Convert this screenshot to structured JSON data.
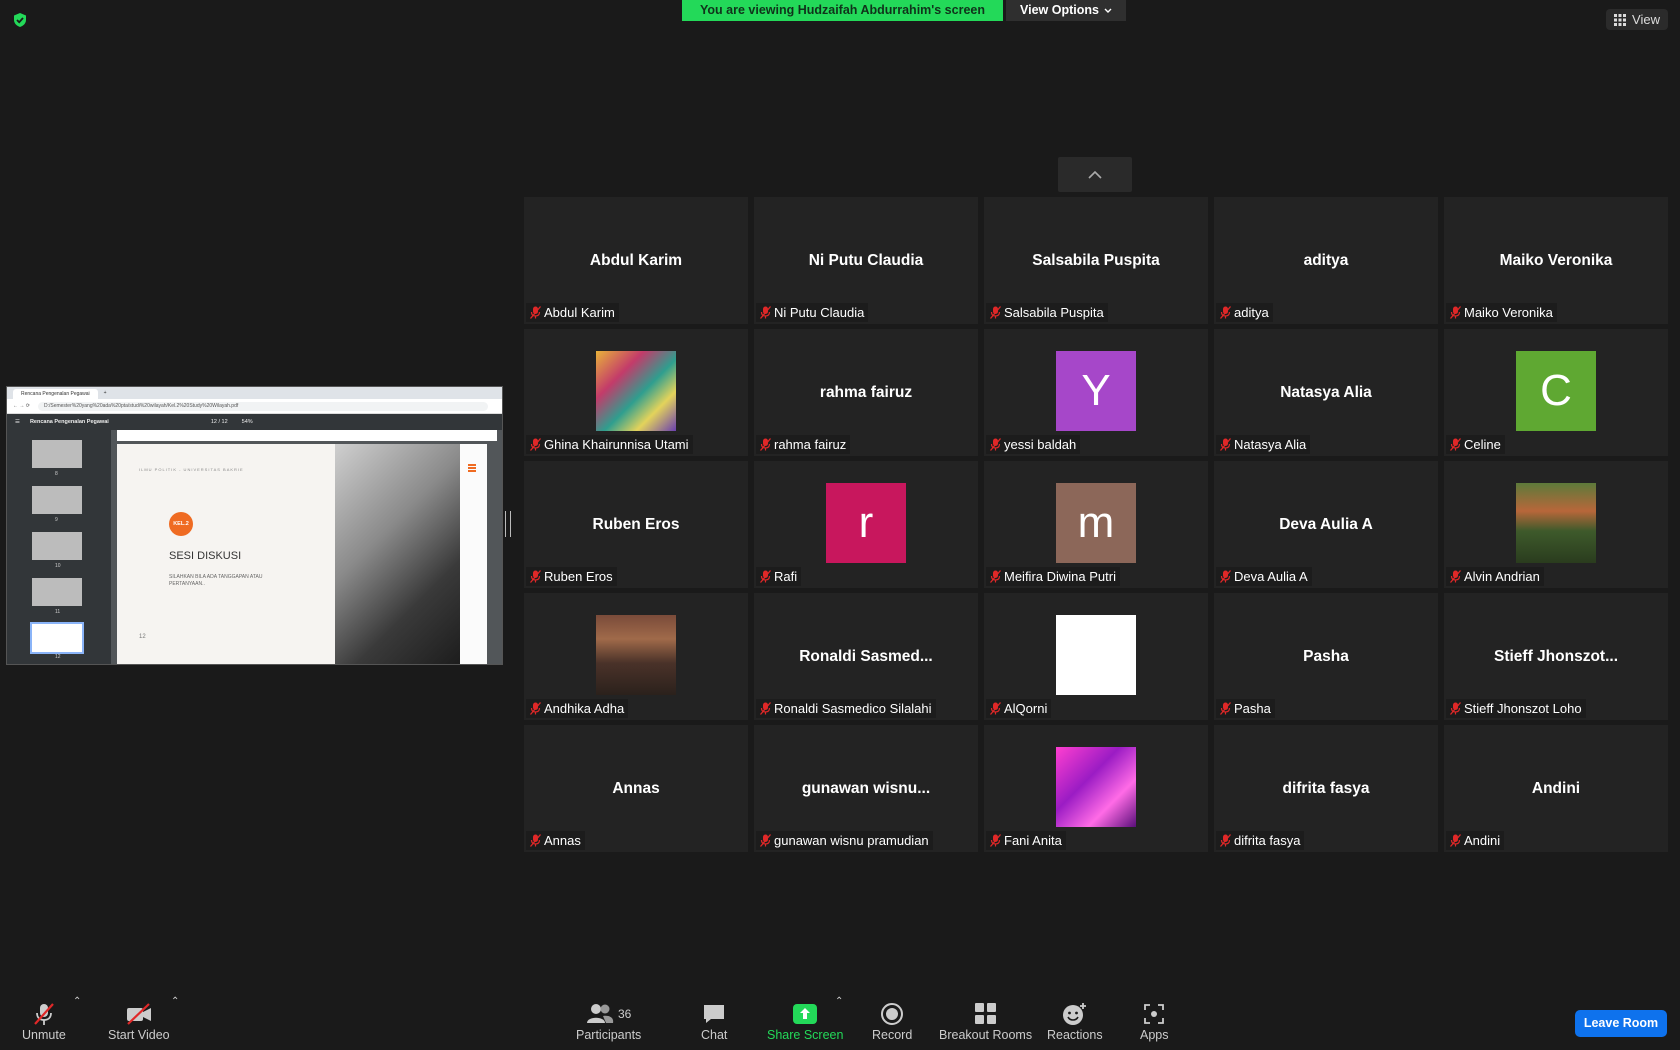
{
  "banner": {
    "message": "You are viewing Hudzaifah Abdurrahim's screen",
    "options": "View Options"
  },
  "view_button": "View",
  "shared_screen": {
    "tab": "Rencana Pengenalan Pegawai",
    "url": "D:/Semester%20yang%20ada%20pta/studi%20wilayah/Kel.2%20Study%20Wilayah.pdf",
    "doc_title": "Rencana Pengenalan Pegawai",
    "page": "12 / 12",
    "zoom": "54%",
    "thumb_numbers": [
      "8",
      "9",
      "10",
      "11",
      "12"
    ],
    "slide": {
      "header": "ILMU POLITIK - UNIVERSITAS BAKRIE",
      "badge": "KEL.2",
      "title": "SESI DISKUSI",
      "desc": "SILAHKAN BILA ADA TANGGAPAN ATAU PERTANYAAN..",
      "num": "12"
    }
  },
  "participants": [
    {
      "big": "Abdul Karim",
      "label": "Abdul Karim"
    },
    {
      "big": "Ni Putu Claudia",
      "label": "Ni Putu Claudia"
    },
    {
      "big": "Salsabila Puspita",
      "label": "Salsabila Puspita"
    },
    {
      "big": "aditya",
      "label": "aditya"
    },
    {
      "big": "Maiko Veronika",
      "label": "Maiko Veronika"
    },
    {
      "avatar": "photo-colorful-wall",
      "label": "Ghina Khairunnisa Utami"
    },
    {
      "big": "rahma fairuz",
      "label": "rahma fairuz"
    },
    {
      "avatar": "letter",
      "letter": "Y",
      "color": "#a647c9",
      "label": "yessi baldah"
    },
    {
      "big": "Natasya Alia",
      "label": "Natasya Alia"
    },
    {
      "avatar": "letter",
      "letter": "C",
      "color": "#5fa832",
      "label": "Celine"
    },
    {
      "big": "Ruben Eros",
      "label": "Ruben Eros"
    },
    {
      "avatar": "letter",
      "letter": "r",
      "color": "#c8175d",
      "label": "Rafi"
    },
    {
      "avatar": "letter",
      "letter": "m",
      "color": "#8c6759",
      "label": "Meifira Diwina Putri"
    },
    {
      "big": "Deva Aulia A",
      "label": "Deva Aulia A"
    },
    {
      "avatar": "photo-garden",
      "label": "Alvin Andrian"
    },
    {
      "avatar": "photo-portrait",
      "label": "Andhika Adha"
    },
    {
      "big": "Ronaldi  Sasmed...",
      "label": "Ronaldi Sasmedico Silalahi"
    },
    {
      "avatar": "letter",
      "letter": "",
      "color": "#ffffff",
      "label": "AlQorni"
    },
    {
      "big": "Pasha",
      "label": "Pasha"
    },
    {
      "big": "Stieff  Jhonszot...",
      "label": "Stieff Jhonszot Loho"
    },
    {
      "big": "Annas",
      "label": "Annas"
    },
    {
      "big": "gunawan  wisnu...",
      "label": "gunawan wisnu pramudian"
    },
    {
      "avatar": "photo-pink-lights",
      "label": "Fani Anita"
    },
    {
      "big": "difrita fasya",
      "label": "difrita fasya"
    },
    {
      "big": "Andini",
      "label": "Andini"
    }
  ],
  "toolbar": {
    "unmute": "Unmute",
    "start_video": "Start Video",
    "participants": "Participants",
    "participants_count": "36",
    "chat": "Chat",
    "share_screen": "Share Screen",
    "record": "Record",
    "breakout_rooms": "Breakout Rooms",
    "reactions": "Reactions",
    "apps": "Apps",
    "leave": "Leave Room"
  },
  "colors": {
    "share_green": "#23d959",
    "leave_blue": "#0e72ed",
    "mic_red": "#e02828"
  }
}
